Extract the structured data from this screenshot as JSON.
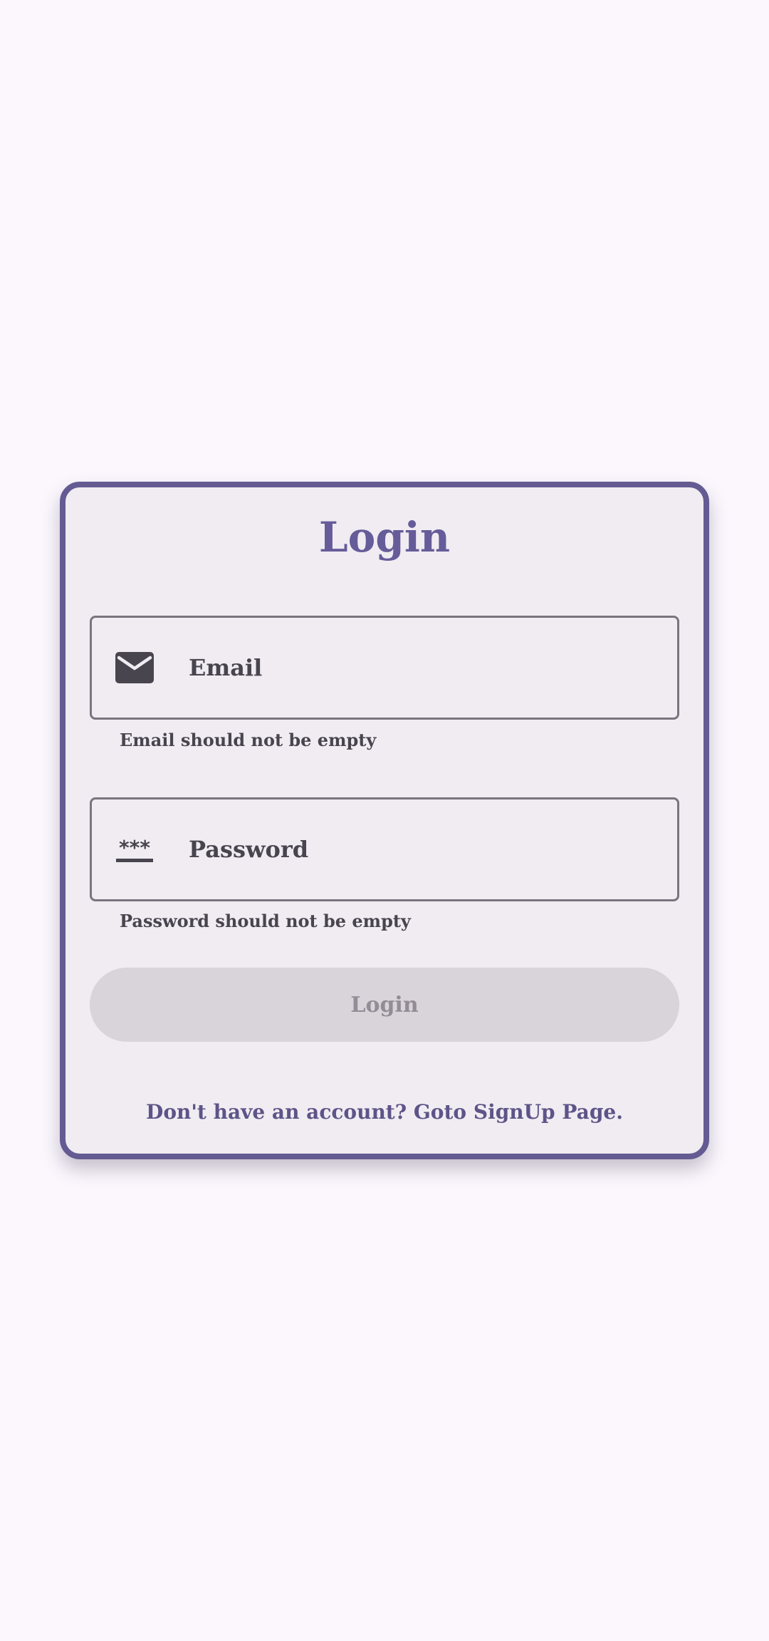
{
  "login_card": {
    "title": "Login",
    "email_field": {
      "label": "Email",
      "icon": "email-icon",
      "error": "Email should not be empty"
    },
    "password_field": {
      "label": "Password",
      "icon": "password-icon",
      "error": "Password should not be empty"
    },
    "login_button": {
      "label": "Login",
      "enabled": false
    },
    "signup_link": "Don't have an account? Goto SignUp Page."
  },
  "colors": {
    "background": "#FBF7FD",
    "card_background": "#F0ECF2",
    "accent": "#645B93",
    "disabled_button": "#D9D3DA",
    "text": "#49454F"
  }
}
